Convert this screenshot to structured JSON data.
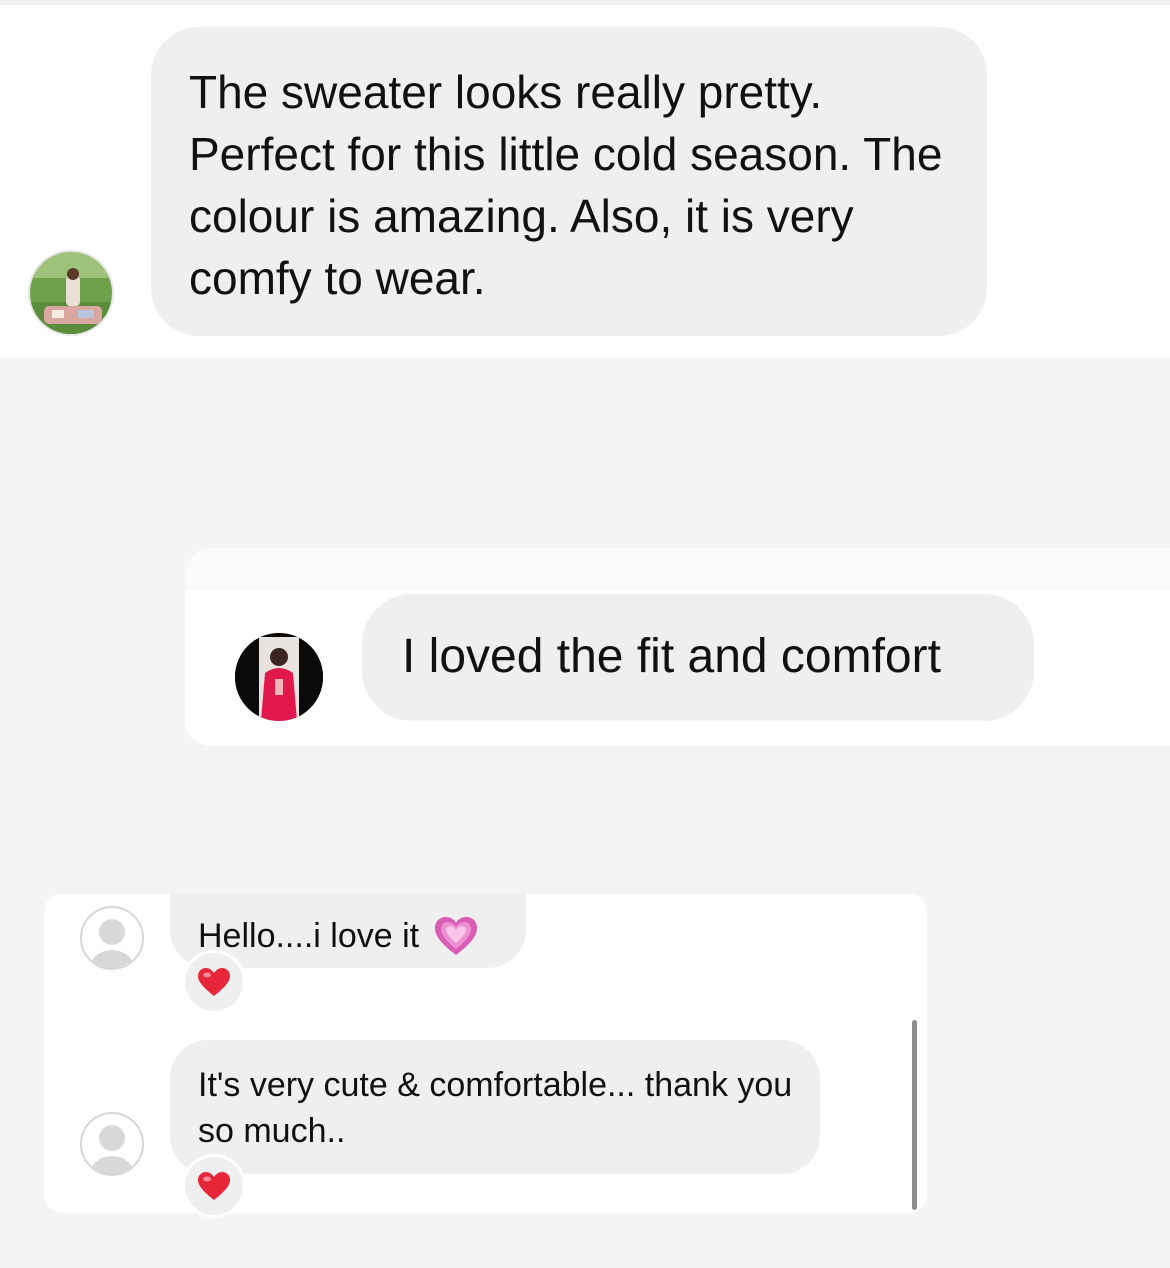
{
  "colors": {
    "page_bg": "#f4f4f4",
    "panel_bg": "#ffffff",
    "bubble_bg": "#efefef",
    "reaction_heart": "#e8263a",
    "emoji_heart": "#e879c6"
  },
  "comments": [
    {
      "text": "The sweater looks really pretty. Perfect for this little cold season. The colour is amazing. Also, it is very comfy to wear.",
      "avatar_icon": "user-photo-avatar"
    },
    {
      "text": "I loved the fit and comfort",
      "avatar_icon": "user-photo-avatar"
    }
  ],
  "chat": {
    "messages": [
      {
        "text": "Hello....i love it",
        "emoji_icon": "growing-heart-icon",
        "avatar_icon": "default-user-icon",
        "reaction_icon": "red-heart-icon"
      },
      {
        "text": "It's very cute & comfortable... thank you so much..",
        "avatar_icon": "default-user-icon",
        "reaction_icon": "red-heart-icon"
      }
    ]
  }
}
